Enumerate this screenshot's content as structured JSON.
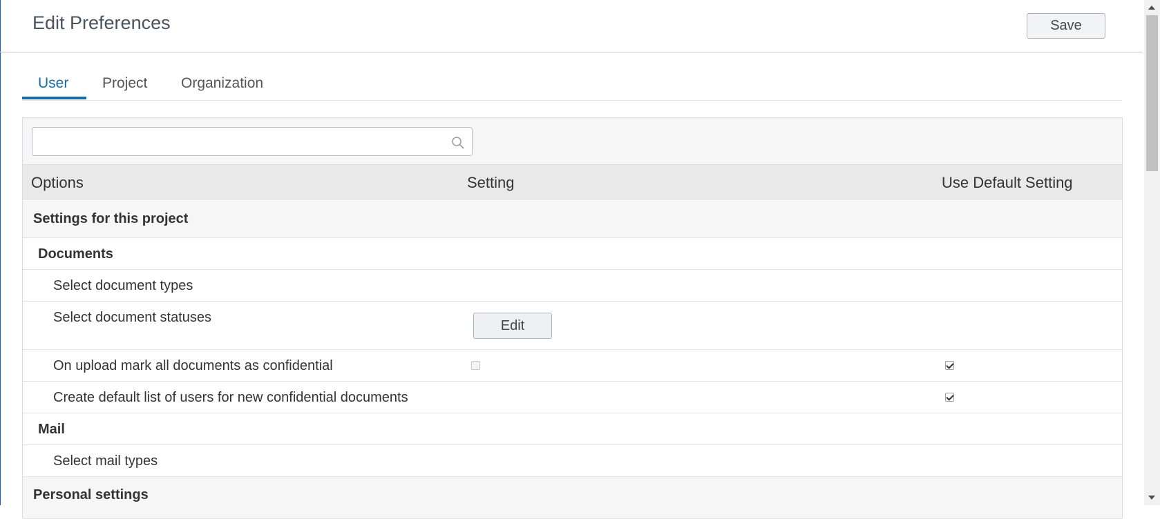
{
  "header": {
    "title": "Edit Preferences",
    "save_label": "Save"
  },
  "tabs": [
    {
      "label": "User",
      "active": true
    },
    {
      "label": "Project",
      "active": false
    },
    {
      "label": "Organization",
      "active": false
    }
  ],
  "search": {
    "value": "",
    "placeholder": ""
  },
  "columns": {
    "options": "Options",
    "setting": "Setting",
    "use_default": "Use Default Setting"
  },
  "rows": [
    {
      "type": "section",
      "label": "Settings for this project"
    },
    {
      "type": "group",
      "label": "Documents"
    },
    {
      "type": "item",
      "label": "Select document types"
    },
    {
      "type": "item",
      "label": "Select document statuses",
      "button": "Edit"
    },
    {
      "type": "item",
      "label": "On upload mark all documents as confidential",
      "setting_checked": false,
      "setting_disabled": true,
      "use_default_checked": true
    },
    {
      "type": "item",
      "label": "Create default list of users for new confidential documents",
      "use_default_checked": true
    },
    {
      "type": "group",
      "label": "Mail"
    },
    {
      "type": "item",
      "label": "Select mail types"
    },
    {
      "type": "section",
      "label": "Personal settings"
    }
  ],
  "colors": {
    "accent": "#1a6aa5",
    "header_bg": "#e9e9e9",
    "section_bg": "#f6f6f6"
  }
}
